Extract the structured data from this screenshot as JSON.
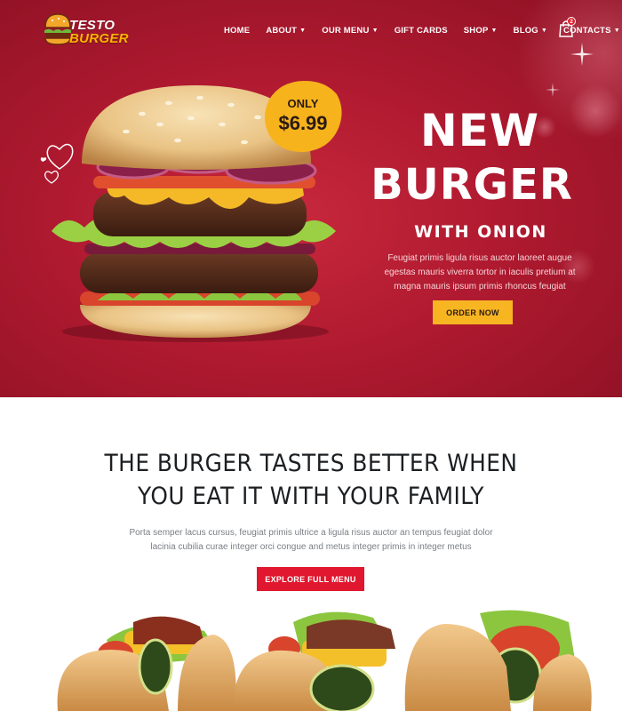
{
  "header": {
    "logo": {
      "line1": "TESTO",
      "line2": "BURGER"
    },
    "nav": [
      {
        "label": "HOME",
        "has_dropdown": false
      },
      {
        "label": "ABOUT",
        "has_dropdown": true
      },
      {
        "label": "OUR MENU",
        "has_dropdown": true
      },
      {
        "label": "GIFT CARDS",
        "has_dropdown": false
      },
      {
        "label": "SHOP",
        "has_dropdown": true
      },
      {
        "label": "BLOG",
        "has_dropdown": true
      },
      {
        "label": "CONTACTS",
        "has_dropdown": true
      }
    ],
    "cart": {
      "icon": "shopping-bag-icon",
      "count": "2"
    }
  },
  "hero": {
    "price_badge": {
      "label": "ONLY",
      "price": "$6.99"
    },
    "title_line1": "NEW",
    "title_line2": "BURGER",
    "subtitle": "WITH ONION",
    "description_line1": "Feugiat primis ligula risus auctor laoreet augue",
    "description_line2": "egestas mauris viverra tortor in iaculis pretium at",
    "description_line3": "magna mauris ipsum primis rhoncus feugiat",
    "cta_label": "ORDER NOW"
  },
  "intro": {
    "title_line1": "THE BURGER TASTES BETTER WHEN",
    "title_line2": "YOU EAT IT WITH YOUR FAMILY",
    "description_line1": "Porta semper lacus cursus, feugiat primis ultrice a ligula risus auctor an tempus feugiat dolor",
    "description_line2": "lacinia cubilia curae integer orci congue and metus integer primis in integer metus",
    "cta_label": "EXPLORE FULL MENU"
  },
  "colors": {
    "hero_red": "#b01a30",
    "accent_yellow": "#f7b522",
    "button_red": "#e0172e",
    "heading_dark": "#1c1f22"
  }
}
